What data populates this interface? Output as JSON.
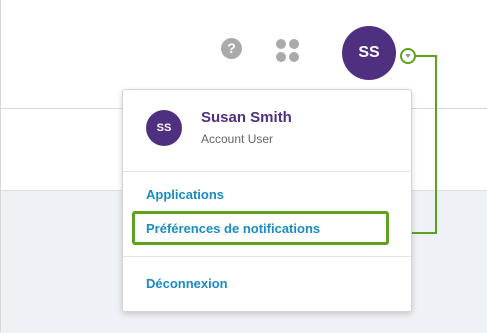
{
  "header": {
    "help_glyph": "?",
    "avatar_initials": "SS",
    "icons": [
      "help-icon",
      "apps-grid-icon",
      "chevron-down-icon"
    ]
  },
  "dropdown": {
    "avatar_initials": "SS",
    "user_name": "Susan Smith",
    "user_role": "Account User",
    "menu": {
      "applications": "Applications",
      "notification_preferences": "Préférences de notifications",
      "logout": "Déconnexion"
    }
  },
  "colors": {
    "brand_purple": "#4f2f7f",
    "link_blue": "#1a8cc4",
    "highlight_green": "#5da11f",
    "icon_gray": "#aaaaaa"
  }
}
